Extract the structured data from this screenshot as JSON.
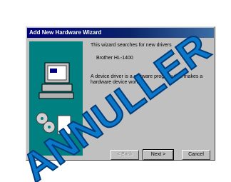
{
  "window": {
    "title": "Add New Hardware Wizard"
  },
  "content": {
    "line1": "This wizard searches for new drivers",
    "device": "Brother HL-1400",
    "line3": "A device driver is a software program that makes a",
    "line4": "hardware device work."
  },
  "buttons": {
    "back": "< Back",
    "next": "Next >",
    "cancel": "Cancel"
  },
  "stamp": {
    "text": "ANNULLER",
    "color": "#0a77c9"
  }
}
